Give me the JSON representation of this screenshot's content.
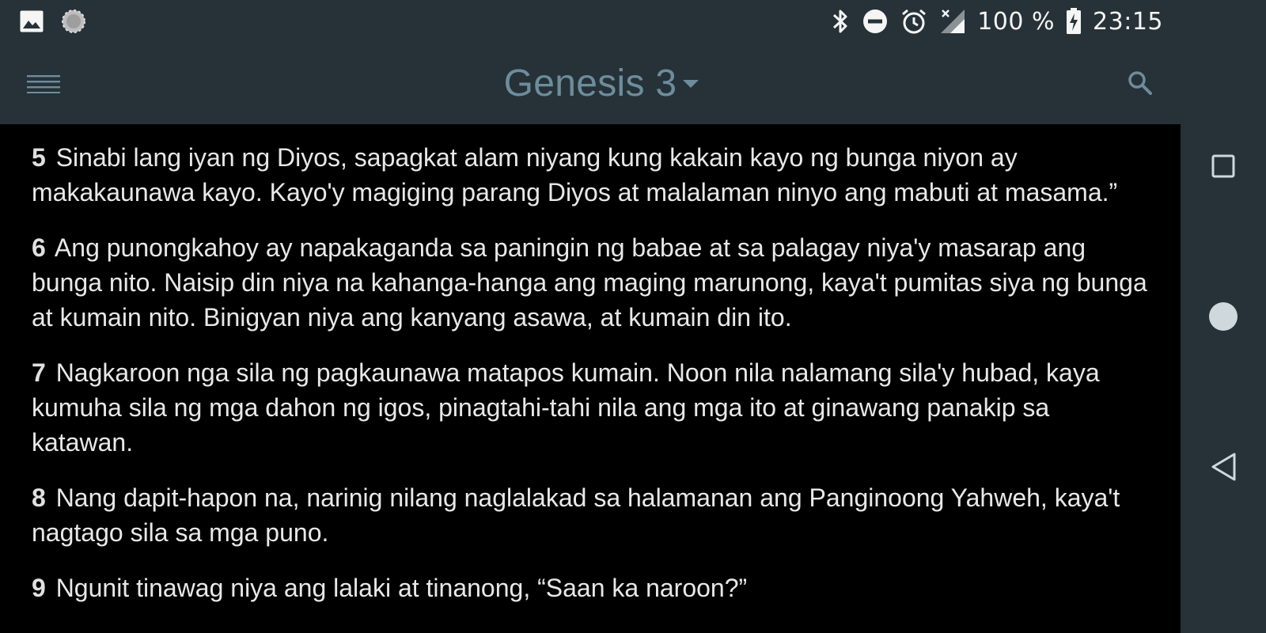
{
  "status_bar": {
    "left_icons": [
      "image-icon",
      "loading-icon"
    ],
    "right_icons": [
      "bluetooth-icon",
      "do-not-disturb-icon",
      "alarm-icon",
      "no-signal-icon"
    ],
    "battery_percent": "100 %",
    "time": "23:15"
  },
  "toolbar": {
    "menu_icon": "hamburger-menu-icon",
    "title": "Genesis 3",
    "dropdown_icon": "caret-down-icon",
    "search_icon": "search-icon"
  },
  "verses": [
    {
      "number": "5",
      "text": "Sinabi lang iyan ng Diyos, sapagkat alam niyang kung kakain kayo ng bunga niyon ay makakaunawa kayo. Kayo'y magiging parang Diyos at malalaman ninyo ang mabuti at masama.”"
    },
    {
      "number": "6",
      "text": "Ang punongkahoy ay napakaganda sa paningin ng babae at sa palagay niya'y masarap ang bunga nito. Naisip din niya na kahanga-hanga ang maging marunong, kaya't pumitas siya ng bunga at kumain nito. Binigyan niya ang kanyang asawa, at kumain din ito."
    },
    {
      "number": "7",
      "text": "Nagkaroon nga sila ng pagkaunawa matapos kumain. Noon nila nalamang sila'y hubad, kaya kumuha sila ng mga dahon ng igos, pinagtahi-tahi nila ang mga ito at ginawang panakip sa katawan."
    },
    {
      "number": "8",
      "text": "Nang dapit-hapon na, narinig nilang naglalakad sa halamanan ang Panginoong Yahweh, kaya't nagtago sila sa mga puno."
    },
    {
      "number": "9",
      "text": "Ngunit tinawag niya ang lalaki at tinanong, “Saan ka naroon?”"
    }
  ],
  "nav_bar": {
    "buttons": [
      "recents-icon",
      "home-icon",
      "back-icon"
    ]
  },
  "colors": {
    "bar_background": "#263238",
    "title": "#6d8d9c",
    "content_background": "#000000",
    "verse_text": "#e8e8e8",
    "nav_icons": "#cfd8dc"
  }
}
